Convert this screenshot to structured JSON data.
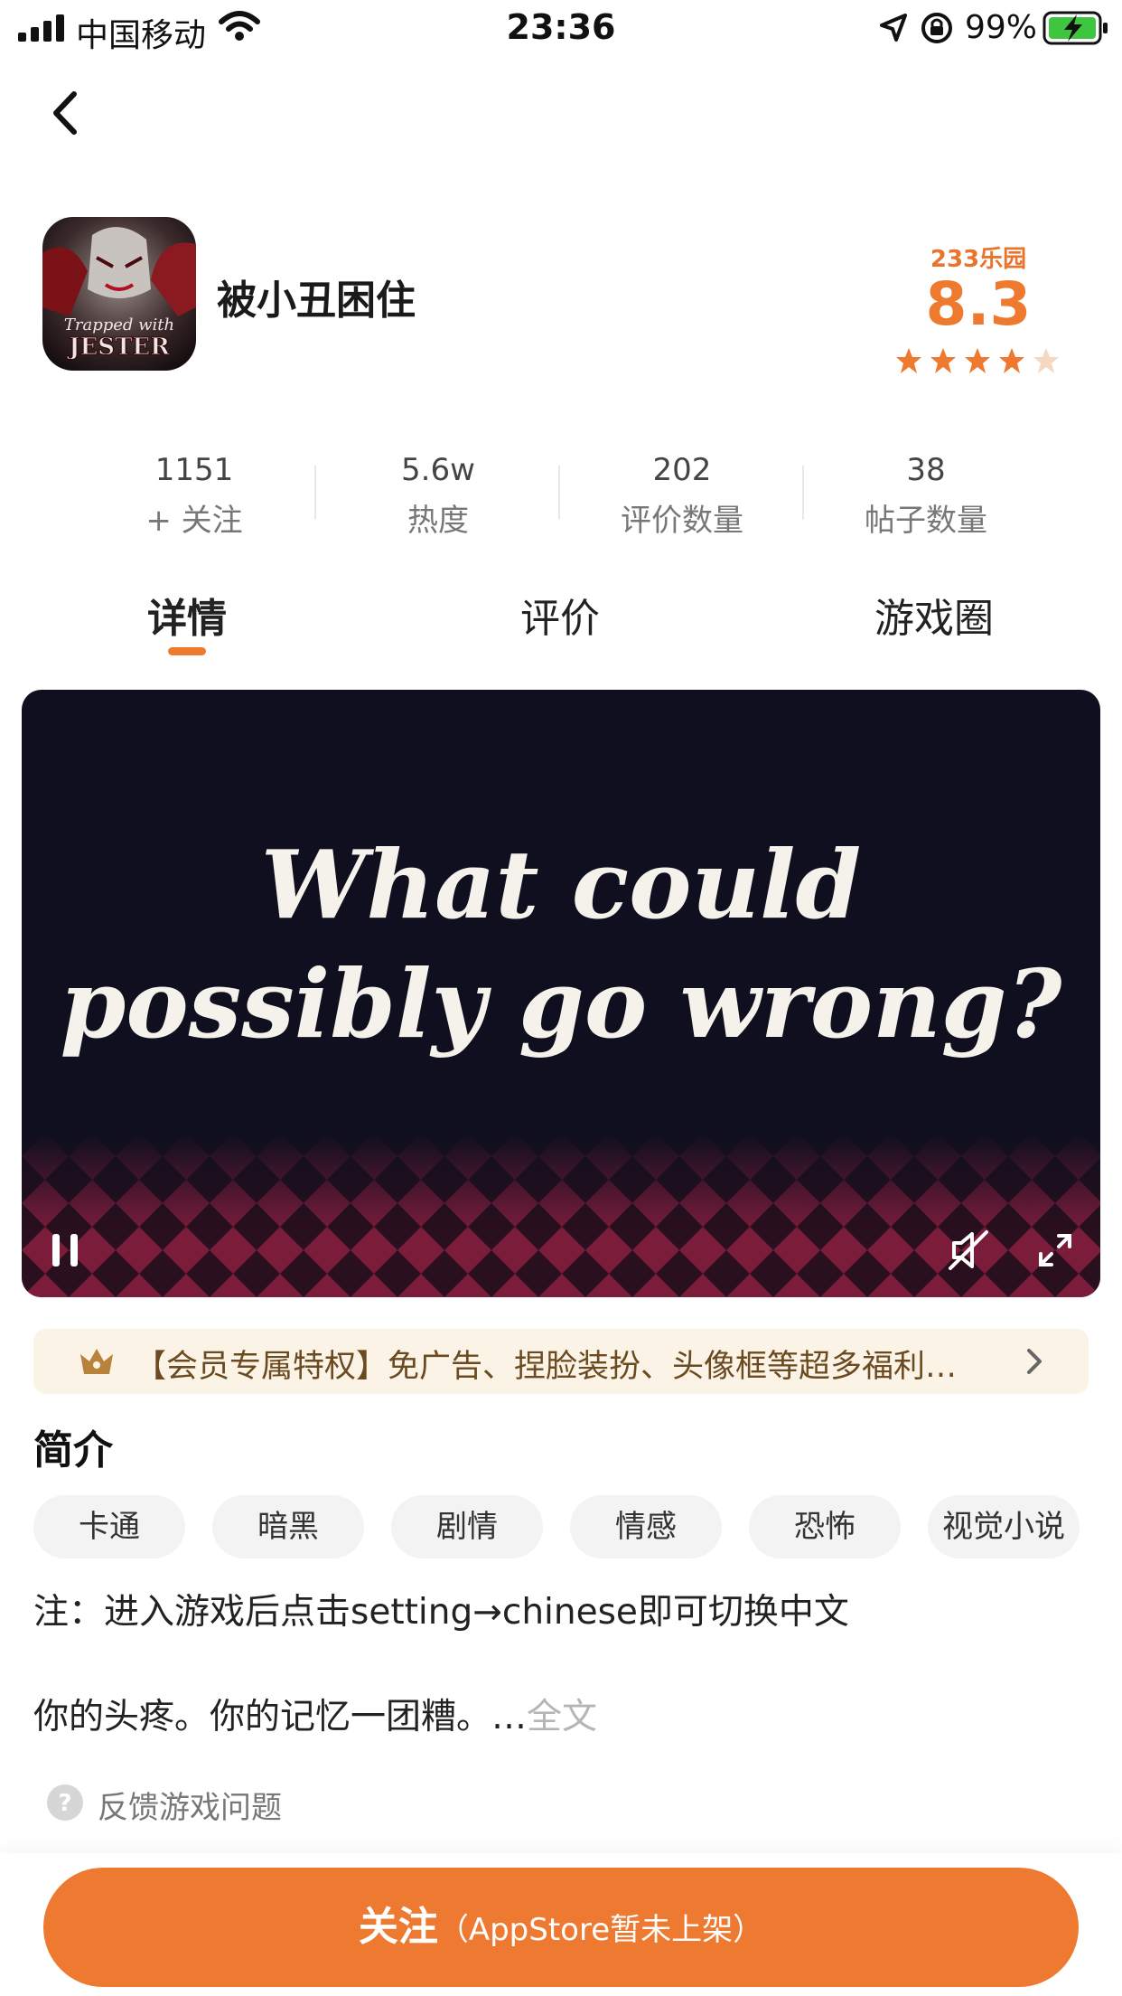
{
  "status_bar": {
    "carrier": "中国移动",
    "time": "23:36",
    "battery": "99%"
  },
  "app": {
    "title": "被小丑困住",
    "icon_text_top": "Trapped with",
    "icon_text_bottom": "JESTER",
    "brand": "233乐园",
    "rating": "8.3",
    "stars_filled": 4,
    "stars_total": 5
  },
  "stats": [
    {
      "value": "1151",
      "label": "+ 关注"
    },
    {
      "value": "5.6w",
      "label": "热度"
    },
    {
      "value": "202",
      "label": "评价数量"
    },
    {
      "value": "38",
      "label": "帖子数量"
    }
  ],
  "tabs": [
    "详情",
    "评价",
    "游戏圈"
  ],
  "video": {
    "line1": "What could",
    "line2": "possibly go wrong?"
  },
  "vip_banner": "【会员专属特权】免广告、捏脸装扮、头像框等超多福利…",
  "intro": {
    "title": "简介",
    "tags": [
      "卡通",
      "暗黑",
      "剧情",
      "情感",
      "恐怖",
      "视觉小说"
    ],
    "note": "注：进入游戏后点击setting→chinese即可切换中文",
    "summary": "你的头疼。你的记忆一团糟。…",
    "more": "全文"
  },
  "feedback": "反馈游戏问题",
  "follow_button": {
    "main": "关注",
    "sub": "（AppStore暂未上架）"
  },
  "colors": {
    "accent": "#ee7a31",
    "vip_bg": "#fbf4e6",
    "video_bg": "#0f0f1f"
  }
}
